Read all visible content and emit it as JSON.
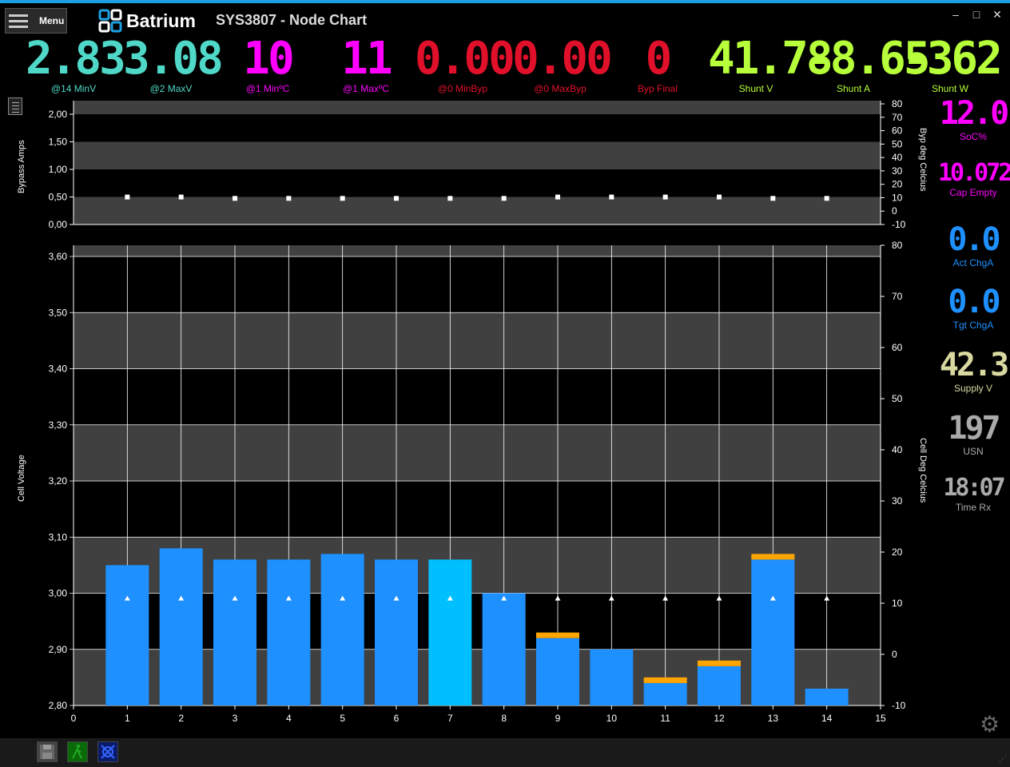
{
  "menu": {
    "label": "Menu"
  },
  "logo": {
    "text": "Batrium"
  },
  "window": {
    "title": "SYS3807 - Node Chart"
  },
  "window_controls": {
    "minimize": "–",
    "maximize": "□",
    "close": "✕"
  },
  "top_readouts": [
    {
      "value": "2.83",
      "label": "@14 MinV",
      "color": "#4fd8c8",
      "ghost": "8.88"
    },
    {
      "value": "3.08",
      "label": "@2 MaxV",
      "color": "#4fd8c8",
      "ghost": "8.88"
    },
    {
      "value": "10",
      "label": "@1 MinºC",
      "color": "#ff00ff",
      "ghost": "88"
    },
    {
      "value": "11",
      "label": "@1 MaxºC",
      "color": "#ff00ff",
      "ghost": "88"
    },
    {
      "value": "0.00",
      "label": "@0 MinByp",
      "color": "#e0102a",
      "ghost": "8.88"
    },
    {
      "value": "0.00",
      "label": "@0 MaxByp",
      "color": "#e0102a",
      "ghost": "8.88"
    },
    {
      "value": "0",
      "label": "Byp Final",
      "color": "#e0102a",
      "ghost": "8"
    },
    {
      "value": "41.78",
      "label": "Shunt V",
      "color": "#b6ff3a",
      "ghost": "88.88"
    },
    {
      "value": "-8.65",
      "label": "Shunt A",
      "color": "#b6ff3a",
      "ghost": "-8.88"
    },
    {
      "value": "-362",
      "label": "Shunt W",
      "color": "#b6ff3a",
      "ghost": "-888"
    }
  ],
  "side_readouts": [
    {
      "value": "12.0",
      "label": "SoC%",
      "color": "#ff00ff"
    },
    {
      "value": "10.072",
      "label": "Cap Empty",
      "color": "#ff00ff"
    },
    {
      "value": "0.0",
      "label": "Act ChgA",
      "color": "#1e90ff"
    },
    {
      "value": "0.0",
      "label": "Tgt ChgA",
      "color": "#1e90ff"
    },
    {
      "value": "42.3",
      "label": "Supply V",
      "color": "#d8d8a0"
    },
    {
      "value": "197",
      "label": "USN",
      "color": "#aaaaaa"
    },
    {
      "value": "18:07",
      "label": "Time Rx",
      "color": "#aaaaaa"
    }
  ],
  "colors": {
    "bar": "#1e90ff",
    "bar_highlight": "#00bfff",
    "bypass_cap": "#ffa500",
    "band_dark": "#000000",
    "band_light": "#404040",
    "grid": "#ffffff"
  },
  "chart_data": [
    {
      "type": "scatter",
      "ylabel": "Bypass Amps",
      "y2label": "Byp deg Celcius",
      "ylim": [
        0,
        2.0
      ],
      "y2lim": [
        -10,
        80
      ],
      "yticks": [
        "0,00",
        "0,50",
        "1,00",
        "1,50",
        "2,00"
      ],
      "y2ticks": [
        "-10",
        "0",
        "10",
        "20",
        "30",
        "40",
        "50",
        "60",
        "70",
        "80"
      ],
      "x": [
        1,
        2,
        3,
        4,
        5,
        6,
        7,
        8,
        9,
        10,
        11,
        12,
        13,
        14
      ],
      "y2_values": [
        10.5,
        10.5,
        9.5,
        9.5,
        9.5,
        9.5,
        9.5,
        9.5,
        10.5,
        10.5,
        10.5,
        10.5,
        9.5,
        9.5
      ]
    },
    {
      "type": "bar",
      "ylabel": "Cell Voltage",
      "y2label": "Cell Deg Celcius",
      "ylim": [
        2.8,
        3.62
      ],
      "y2lim": [
        -10,
        80
      ],
      "xlim": [
        0,
        15
      ],
      "xticks": [
        "0",
        "1",
        "2",
        "3",
        "4",
        "5",
        "6",
        "7",
        "8",
        "9",
        "10",
        "11",
        "12",
        "13",
        "14",
        "15"
      ],
      "yticks": [
        "2,80",
        "2,90",
        "3,00",
        "3,10",
        "3,20",
        "3,30",
        "3,40",
        "3,50",
        "3,60"
      ],
      "y2ticks": [
        "-10",
        "0",
        "10",
        "20",
        "30",
        "40",
        "50",
        "60",
        "70",
        "80"
      ],
      "categories": [
        "1",
        "2",
        "3",
        "4",
        "5",
        "6",
        "7",
        "8",
        "9",
        "10",
        "11",
        "12",
        "13",
        "14"
      ],
      "series": [
        {
          "name": "Cell Voltage",
          "values": [
            3.05,
            3.08,
            3.06,
            3.06,
            3.07,
            3.06,
            3.06,
            3.0,
            2.92,
            2.9,
            2.84,
            2.87,
            3.06,
            2.83
          ]
        },
        {
          "name": "Bypass",
          "values": [
            0,
            0,
            0,
            0,
            0,
            0,
            0,
            0,
            0.01,
            0,
            0.01,
            0.01,
            0.01,
            0
          ]
        },
        {
          "name": "Cell Deg Celcius",
          "values": [
            11,
            11,
            11,
            11,
            11,
            11,
            11,
            11,
            11,
            11,
            11,
            11,
            11,
            11
          ]
        }
      ],
      "highlight_index": 6,
      "grid": true
    }
  ]
}
